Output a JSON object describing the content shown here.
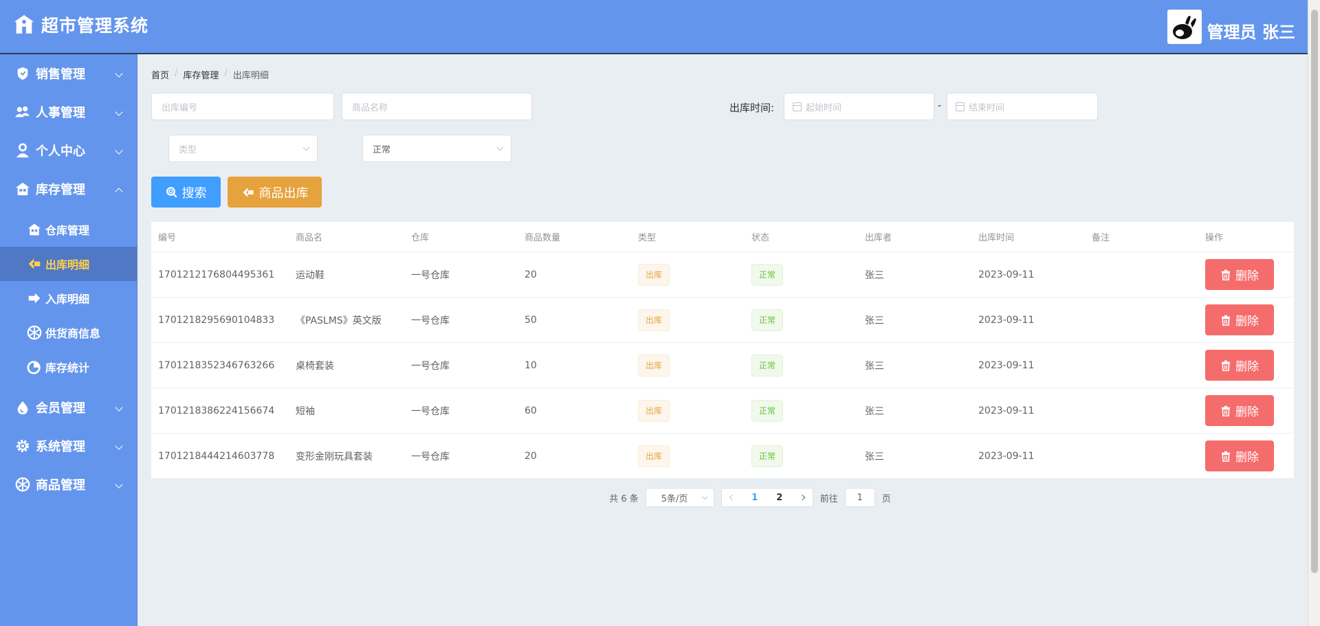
{
  "header": {
    "title": "超市管理系统",
    "user_label": "管理员 张三"
  },
  "sidebar": {
    "items": [
      {
        "label": "销售管理",
        "icon": "shield-icon"
      },
      {
        "label": "人事管理",
        "icon": "users-icon"
      },
      {
        "label": "个人中心",
        "icon": "user-icon"
      },
      {
        "label": "库存管理",
        "icon": "house-icon",
        "children": [
          {
            "label": "仓库管理",
            "icon": "house-icon"
          },
          {
            "label": "出库明细",
            "icon": "arrow-left-icon",
            "active": true
          },
          {
            "label": "入库明细",
            "icon": "arrow-right-icon"
          },
          {
            "label": "供货商信息",
            "icon": "aperture-icon"
          },
          {
            "label": "库存统计",
            "icon": "chart-circle-icon"
          }
        ]
      },
      {
        "label": "会员管理",
        "icon": "drop-icon"
      },
      {
        "label": "系统管理",
        "icon": "gear-icon"
      },
      {
        "label": "商品管理",
        "icon": "aperture-icon"
      }
    ]
  },
  "breadcrumb": {
    "home": "首页",
    "parent": "库存管理",
    "current": "出库明细",
    "separator": "/"
  },
  "filters": {
    "out_no_placeholder": "出库编号",
    "product_placeholder": "商品名称",
    "time_label": "出库时间:",
    "start_placeholder": "起始时间",
    "end_placeholder": "结束时间",
    "range_sep": "-",
    "type_placeholder": "类型",
    "status_value": "正常"
  },
  "actions": {
    "search": "搜索",
    "out": "商品出库"
  },
  "table": {
    "headers": [
      "编号",
      "商品名",
      "仓库",
      "商品数量",
      "类型",
      "状态",
      "出库者",
      "出库时间",
      "备注",
      "操作"
    ],
    "delete_label": "删除",
    "rows": [
      {
        "id": "1701212176804495361",
        "name": "运动鞋",
        "warehouse": "一号仓库",
        "qty": "20",
        "type": "出库",
        "status": "正常",
        "operator": "张三",
        "time": "2023-09-11",
        "remark": ""
      },
      {
        "id": "1701218295690104833",
        "name": "《PASLMS》英文版",
        "warehouse": "一号仓库",
        "qty": "50",
        "type": "出库",
        "status": "正常",
        "operator": "张三",
        "time": "2023-09-11",
        "remark": ""
      },
      {
        "id": "1701218352346763266",
        "name": "桌椅套装",
        "warehouse": "一号仓库",
        "qty": "10",
        "type": "出库",
        "status": "正常",
        "operator": "张三",
        "time": "2023-09-11",
        "remark": ""
      },
      {
        "id": "1701218386224156674",
        "name": "短袖",
        "warehouse": "一号仓库",
        "qty": "60",
        "type": "出库",
        "status": "正常",
        "operator": "张三",
        "time": "2023-09-11",
        "remark": ""
      },
      {
        "id": "1701218444214603778",
        "name": "变形金刚玩具套装",
        "warehouse": "一号仓库",
        "qty": "20",
        "type": "出库",
        "status": "正常",
        "operator": "张三",
        "time": "2023-09-11",
        "remark": ""
      }
    ]
  },
  "pagination": {
    "total": "共 6 条",
    "page_size": "5条/页",
    "pages": [
      "1",
      "2"
    ],
    "current_page": "1",
    "goto_prefix": "前往",
    "goto_value": "1",
    "goto_suffix": "页"
  },
  "colors": {
    "primary": "#409eff",
    "sidebar": "#6495ed",
    "warning": "#e6a23c",
    "danger": "#f56c6c",
    "success": "#67c23a",
    "active_text": "#ffd04b"
  }
}
